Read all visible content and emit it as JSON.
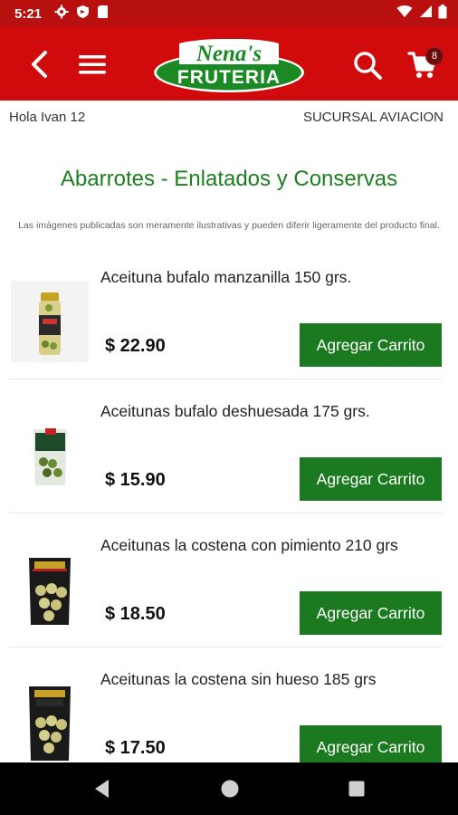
{
  "status_bar": {
    "time": "5:21",
    "icons": [
      "gear-icon",
      "shield-icon",
      "sd-card-icon",
      "wifi-icon",
      "signal-icon",
      "battery-icon"
    ]
  },
  "app_bar": {
    "logo_line1": "Nena's",
    "logo_line2": "FRUTERIA",
    "cart_count": "8",
    "colors": {
      "background": "#d10b0b",
      "status": "#b80f0f"
    }
  },
  "header": {
    "greeting": "Hola Ivan 12",
    "branch": "SUCURSAL AVIACION"
  },
  "category": {
    "title": "Abarrotes - Enlatados y Conservas",
    "disclaimer": "Las imágenes publicadas son meramente ilustrativas y pueden diferir ligeramente del producto final."
  },
  "products": [
    {
      "name": "Aceituna bufalo manzanilla 150 grs.",
      "price": "$ 22.90",
      "button": "Agregar Carrito",
      "image": "olive-jar-image"
    },
    {
      "name": "Aceitunas bufalo deshuesada 175 grs.",
      "price": "$ 15.90",
      "button": "Agregar Carrito",
      "image": "olive-pouch-image"
    },
    {
      "name": "Aceitunas la costena con pimiento 210 grs",
      "price": "$ 18.50",
      "button": "Agregar Carrito",
      "image": "olive-bag-image"
    },
    {
      "name": "Aceitunas la costena sin hueso 185 grs",
      "price": "$ 17.50",
      "button": "Agregar Carrito",
      "image": "olive-bag-image"
    }
  ],
  "theme": {
    "accent_green": "#1b7a1f",
    "title_green": "#1e7e22"
  }
}
